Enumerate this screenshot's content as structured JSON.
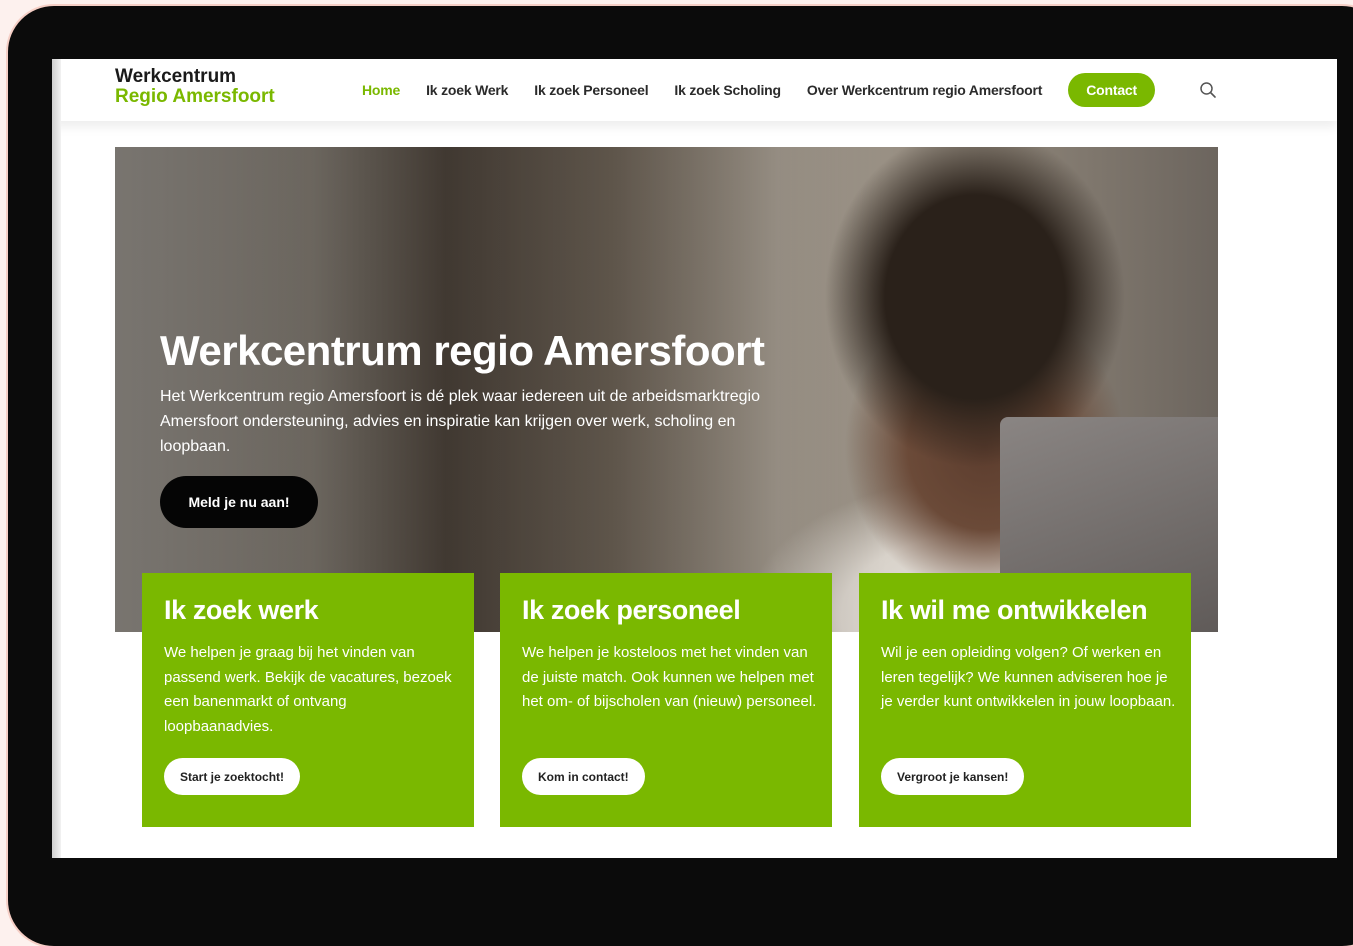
{
  "logo": {
    "line1": "Werkcentrum",
    "line2": "Regio Amersfoort"
  },
  "nav": {
    "items": [
      "Home",
      "Ik zoek Werk",
      "Ik zoek Personeel",
      "Ik zoek Scholing",
      "Over Werkcentrum regio Amersfoort"
    ],
    "contact_label": "Contact",
    "active_item": "Home"
  },
  "hero": {
    "title": "Werkcentrum regio Amersfoort",
    "text": "Het Werkcentrum regio Amersfoort is dé plek waar iedereen uit de arbeidsmarktregio Amersfoort ondersteuning, advies en inspiratie kan krijgen over werk, scholing en loopbaan.",
    "button_label": "Meld je nu aan!"
  },
  "cards": [
    {
      "title": "Ik zoek werk",
      "text": "We helpen je graag bij het vinden van passend werk. Bekijk de vacatures, bezoek een banenmarkt of ontvang loopbaanadvies.",
      "button_label": "Start je zoektocht!"
    },
    {
      "title": "Ik zoek personeel",
      "text": "We helpen je kosteloos met het vinden van de juiste match. Ook kunnen we helpen met het om- of bijscholen van (nieuw) personeel.",
      "button_label": "Kom in contact!"
    },
    {
      "title": "Ik wil me ontwikkelen",
      "text": "Wil je een opleiding volgen? Of werken en leren tegelijk? We kunnen adviseren hoe je je verder kunt ontwikkelen in jouw loopbaan.",
      "button_label": "Vergroot je kansen!"
    }
  ],
  "colors": {
    "brand_green": "#7ab800",
    "text_dark": "#2b2b2b",
    "bezel": "#0b0b0b"
  },
  "icons": {
    "search": "search-icon"
  }
}
